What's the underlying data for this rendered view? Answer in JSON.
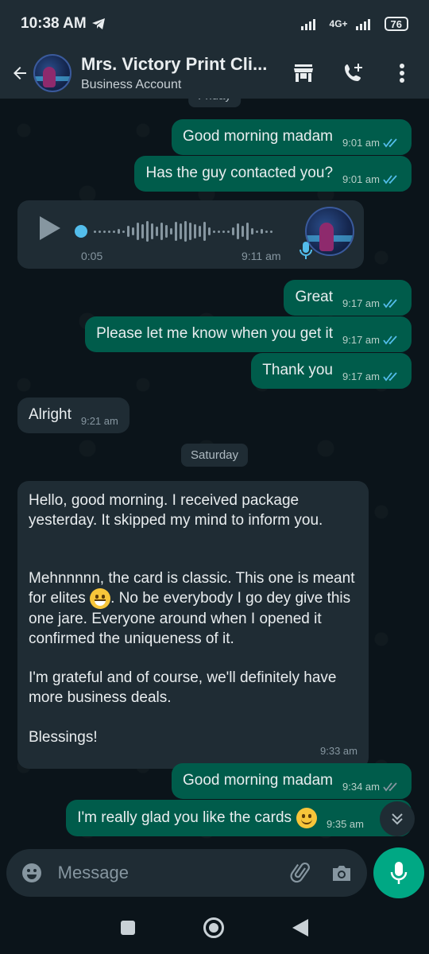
{
  "status_bar": {
    "time": "10:38 AM",
    "network": "4G+",
    "battery": "76"
  },
  "header": {
    "name": "Mrs. Victory Print Cli...",
    "subtitle": "Business Account"
  },
  "chat": {
    "top_day_label": "Friday",
    "messages": [
      {
        "text": "Good morning madam",
        "time": "9:01 am"
      },
      {
        "text": "Has the guy contacted you?",
        "time": "9:01 am"
      },
      {
        "text": "Great",
        "time": "9:17 am"
      },
      {
        "text": "Please let me know when you get it",
        "time": "9:17 am"
      },
      {
        "text": "Thank you",
        "time": "9:17 am"
      },
      {
        "text": "Alright",
        "time": "9:21 am"
      },
      {
        "text": "Good morning madam",
        "time": "9:34 am"
      },
      {
        "text": "I'm really glad you like the cards",
        "time": "9:35 am"
      }
    ],
    "voice": {
      "duration": "0:05",
      "time": "9:11 am"
    },
    "day_separator": "Saturday",
    "long_message": {
      "p1": "Hello, good morning. I received package yesterday. It skipped my mind to inform you.",
      "p2a": "Mehnnnnn, the card is classic. This one is meant for elites",
      "p2b": ". No be everybody I go dey give this one jare. Everyone around when I opened it confirmed the uniqueness of it.",
      "p3": "I'm grateful and of course, we'll definitely have more business deals.",
      "p4": "Blessings!",
      "time": "9:33 am"
    }
  },
  "composer": {
    "placeholder": "Message"
  },
  "colors": {
    "outgoing": "#005c4b",
    "incoming": "#1f2c34",
    "accent": "#00a884",
    "read_ticks": "#53bdeb"
  }
}
